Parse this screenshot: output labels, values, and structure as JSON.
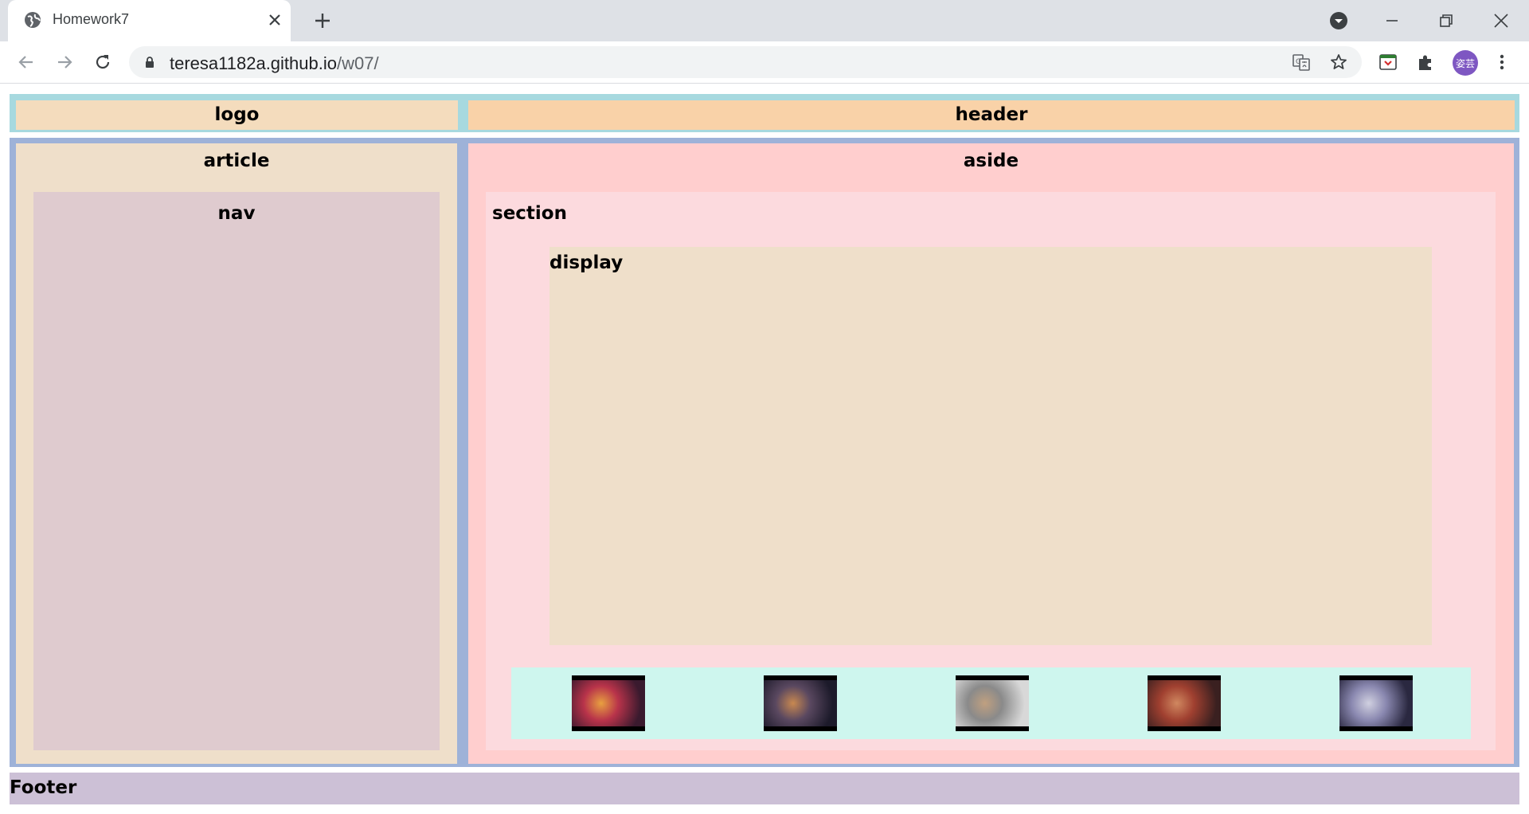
{
  "browser": {
    "tab_title": "Homework7",
    "url_host": "teresa1182a.github.io",
    "url_path": "/w07/",
    "avatar_text": "姿芸"
  },
  "page": {
    "logo": "logo",
    "header": "header",
    "article": "article",
    "nav": "nav",
    "aside": "aside",
    "section": "section",
    "display": "display",
    "footer": "Footer"
  },
  "thumbnails": [
    {
      "name": "video-thumbnail-1",
      "tone": [
        "#3a1a2e",
        "#b8334a",
        "#e8a040"
      ]
    },
    {
      "name": "video-thumbnail-2",
      "tone": [
        "#1c1a2a",
        "#5a4860",
        "#c88850"
      ]
    },
    {
      "name": "video-thumbnail-3",
      "tone": [
        "#d8d8d8",
        "#8a8a8a",
        "#c0a080"
      ]
    },
    {
      "name": "video-thumbnail-4",
      "tone": [
        "#3a2020",
        "#a04030",
        "#d08860"
      ]
    },
    {
      "name": "video-thumbnail-5",
      "tone": [
        "#2a2840",
        "#8a88b0",
        "#d0d0e0"
      ]
    }
  ],
  "colors": {
    "tabstrip": "#dee1e6",
    "header_wrap": "#a7d9df",
    "logo": "#f4dcbd",
    "header": "#f9d2a8",
    "main_wrap": "#9eb2d8",
    "article": "#efdfca",
    "nav": "#dfcbcf",
    "aside": "#ffcece",
    "section": "#fcdade",
    "display": "#efdfca",
    "thumb_strip": "#cef6ee",
    "footer": "#ccc0d6"
  }
}
